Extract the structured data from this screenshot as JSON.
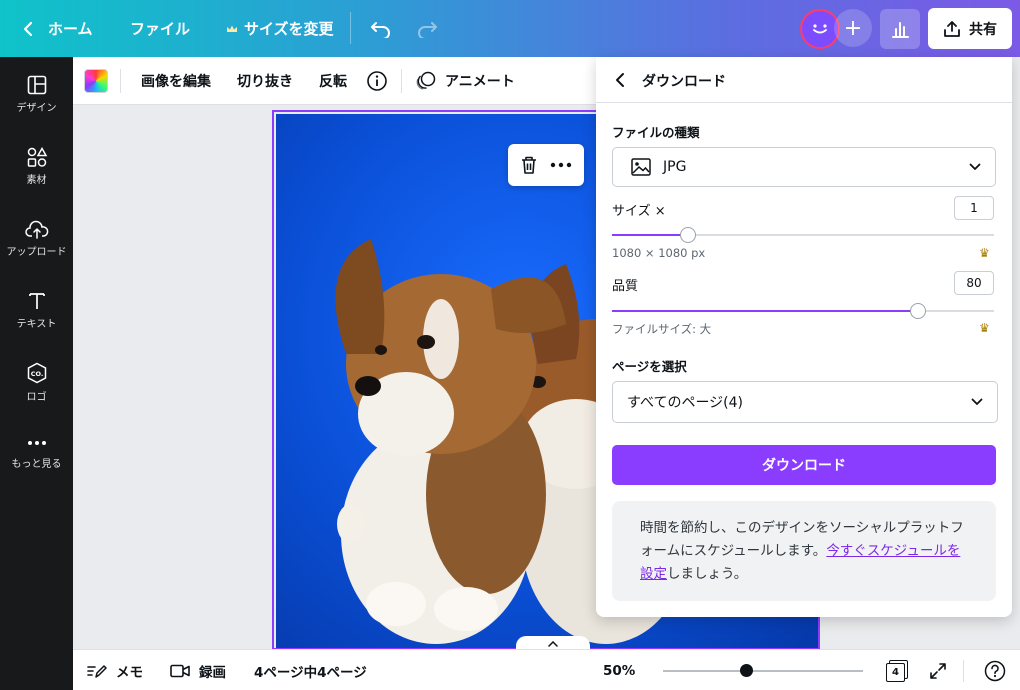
{
  "topbar": {
    "home_label": "ホーム",
    "file_label": "ファイル",
    "resize_label": "サイズを変更",
    "share_label": "共有"
  },
  "sidebar": {
    "items": [
      {
        "label": "デザイン",
        "icon": "layout-icon"
      },
      {
        "label": "素材",
        "icon": "elements-icon"
      },
      {
        "label": "アップロード",
        "icon": "upload-icon"
      },
      {
        "label": "テキスト",
        "icon": "text-icon"
      },
      {
        "label": "ロゴ",
        "icon": "logo-icon"
      },
      {
        "label": "もっと見る",
        "icon": "more-icon"
      }
    ],
    "logo_glyph": "CO."
  },
  "toolbar2": {
    "edit_image": "画像を編集",
    "crop": "切り抜き",
    "flip": "反転",
    "animate": "アニメート"
  },
  "download_panel": {
    "title": "ダウンロード",
    "file_type_label": "ファイルの種類",
    "file_type_value": "JPG",
    "size_label": "サイズ ×",
    "size_value": "1",
    "size_slider_fraction": 0.2,
    "dimensions": "1080 × 1080 px",
    "quality_label": "品質",
    "quality_value": "80",
    "quality_slider_fraction": 0.8,
    "file_size": "ファイルサイズ: 大",
    "pages_label": "ページを選択",
    "pages_value": "すべてのページ(4)",
    "download_button": "ダウンロード",
    "promo_text_1": "時間を節約し、このデザインをソーシャルプラットフォームにスケジュールします。",
    "promo_link": "今すぐスケジュールを設定",
    "promo_text_2": "しましょう。"
  },
  "bottombar": {
    "notes": "メモ",
    "record": "録画",
    "page_info": "4ページ中4ページ",
    "zoom": "50%",
    "page_count": "4"
  },
  "colors": {
    "accent": "#8b3dff",
    "topbar_start": "#0fc3c9",
    "topbar_end": "#7b5ae6",
    "sidebar": "#18191b"
  }
}
